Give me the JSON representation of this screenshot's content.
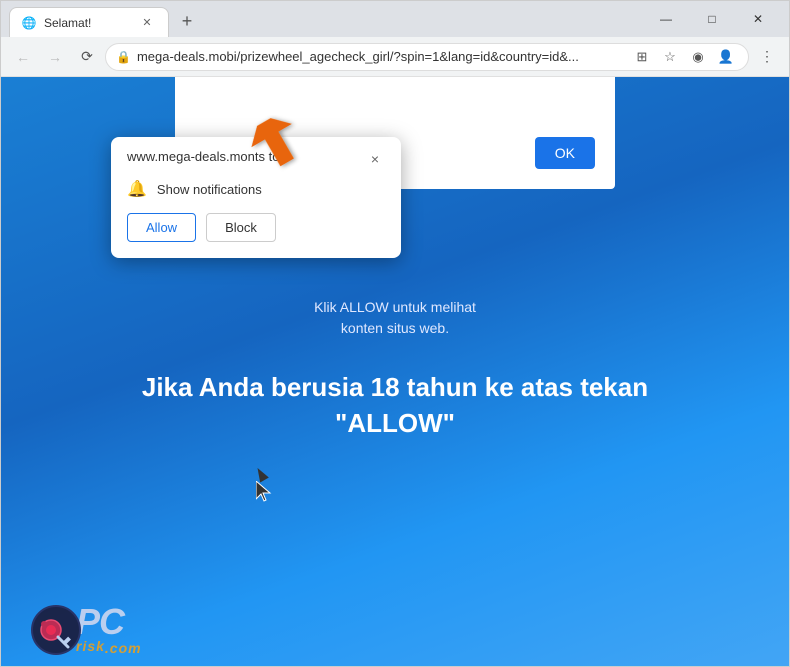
{
  "window": {
    "title": "Selamat!",
    "controls": {
      "minimize": "—",
      "maximize": "□",
      "close": "✕"
    }
  },
  "tab": {
    "favicon": "🌐",
    "title": "Selamat!",
    "close": "✕"
  },
  "new_tab_btn": "+",
  "address_bar": {
    "url": "mega-deals.mobi/prizewheel_agecheck_girl/?spin=1&lang=id&country=id&...",
    "lock": "🔒"
  },
  "notification_popup": {
    "site": "www.mega-deals.mo",
    "wants_to": "nts to",
    "show_notifications": "Show notifications",
    "allow": "Allow",
    "block": "Block",
    "close": "×"
  },
  "page": {
    "ok_button": "OK",
    "click_allow_line1": "Klik ALLOW untuk melihat",
    "click_allow_line2": "konten situs web.",
    "main_heading_line1": "Jika Anda berusia 18 tahun ke atas tekan",
    "main_heading_line2": "\"ALLOW\""
  },
  "watermark": {
    "pc": "PC",
    "risk": "risk",
    "com": ".com"
  }
}
